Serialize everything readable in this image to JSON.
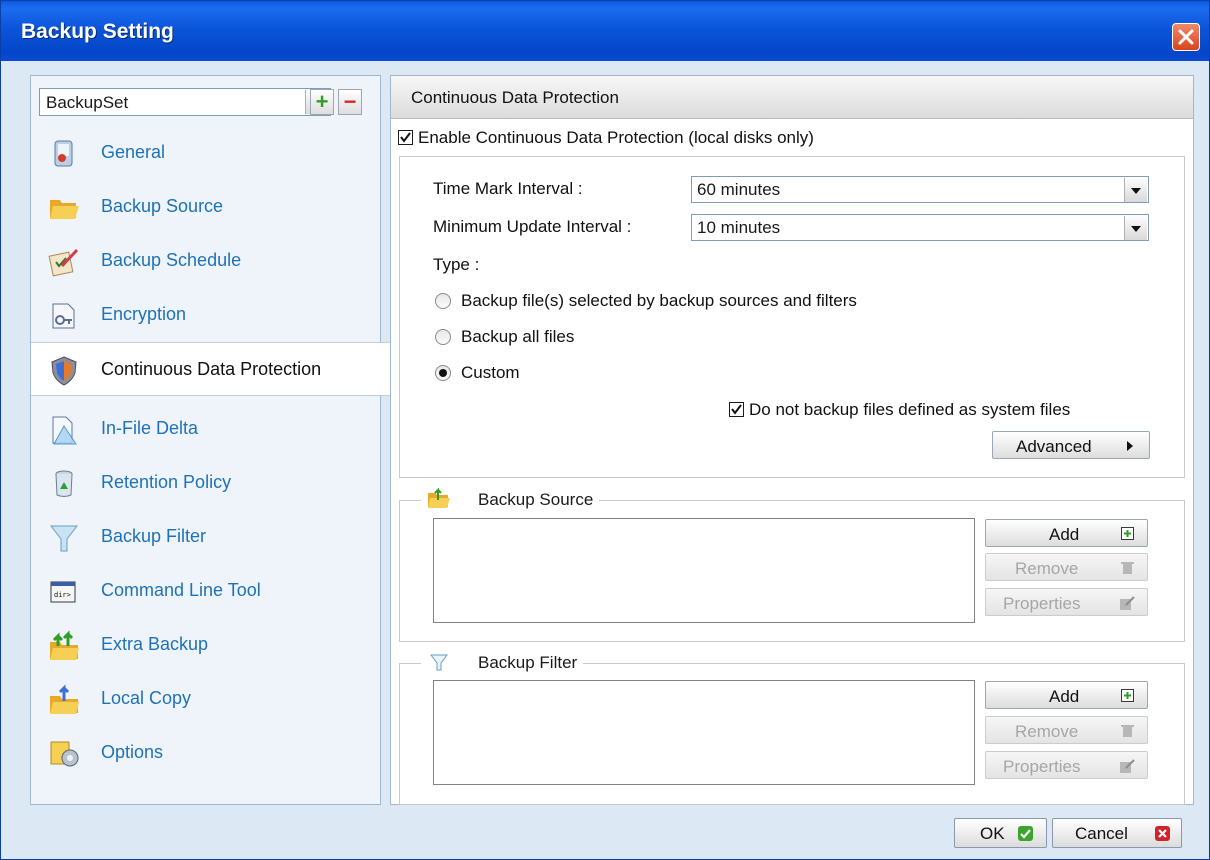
{
  "window": {
    "title": "Backup Setting"
  },
  "sidebar": {
    "backupset_value": "BackupSet",
    "items": [
      {
        "label": "General",
        "icon": "general-icon"
      },
      {
        "label": "Backup Source",
        "icon": "folder-icon"
      },
      {
        "label": "Backup Schedule",
        "icon": "schedule-icon"
      },
      {
        "label": "Encryption",
        "icon": "encryption-icon"
      },
      {
        "label": "Continuous Data Protection",
        "icon": "shield-icon",
        "selected": true
      },
      {
        "label": "In-File Delta",
        "icon": "delta-icon"
      },
      {
        "label": "Retention Policy",
        "icon": "recycle-bin-icon"
      },
      {
        "label": "Backup Filter",
        "icon": "filter-icon"
      },
      {
        "label": "Command Line Tool",
        "icon": "command-line-icon"
      },
      {
        "label": "Extra Backup",
        "icon": "extra-backup-icon"
      },
      {
        "label": "Local Copy",
        "icon": "local-copy-icon"
      },
      {
        "label": "Options",
        "icon": "options-icon"
      }
    ]
  },
  "main": {
    "header": "Continuous Data Protection",
    "enable_label": "Enable Continuous Data Protection (local disks only)",
    "enable_checked": true,
    "time_mark_label": "Time Mark Interval :",
    "time_mark_value": "60 minutes",
    "min_update_label": "Minimum Update Interval :",
    "min_update_value": "10 minutes",
    "type_label": "Type :",
    "type_options": [
      {
        "label": "Backup file(s) selected by backup sources and filters",
        "selected": false
      },
      {
        "label": "Backup all files",
        "selected": false
      },
      {
        "label": "Custom",
        "selected": true
      }
    ],
    "system_files_label": "Do not backup files defined as system files",
    "system_files_checked": true,
    "advanced_label": "Advanced",
    "backup_source": {
      "title": "Backup Source",
      "add_label": "Add",
      "remove_label": "Remove",
      "properties_label": "Properties"
    },
    "backup_filter": {
      "title": "Backup Filter",
      "add_label": "Add",
      "remove_label": "Remove",
      "properties_label": "Properties"
    }
  },
  "footer": {
    "ok_label": "OK",
    "cancel_label": "Cancel"
  },
  "colors": {
    "titlebar": "#0b55d9",
    "nav_link": "#1f71b8",
    "ok_green": "#3aa52a",
    "cancel_red": "#d3232a",
    "panel_bg": "#dce9f5"
  }
}
